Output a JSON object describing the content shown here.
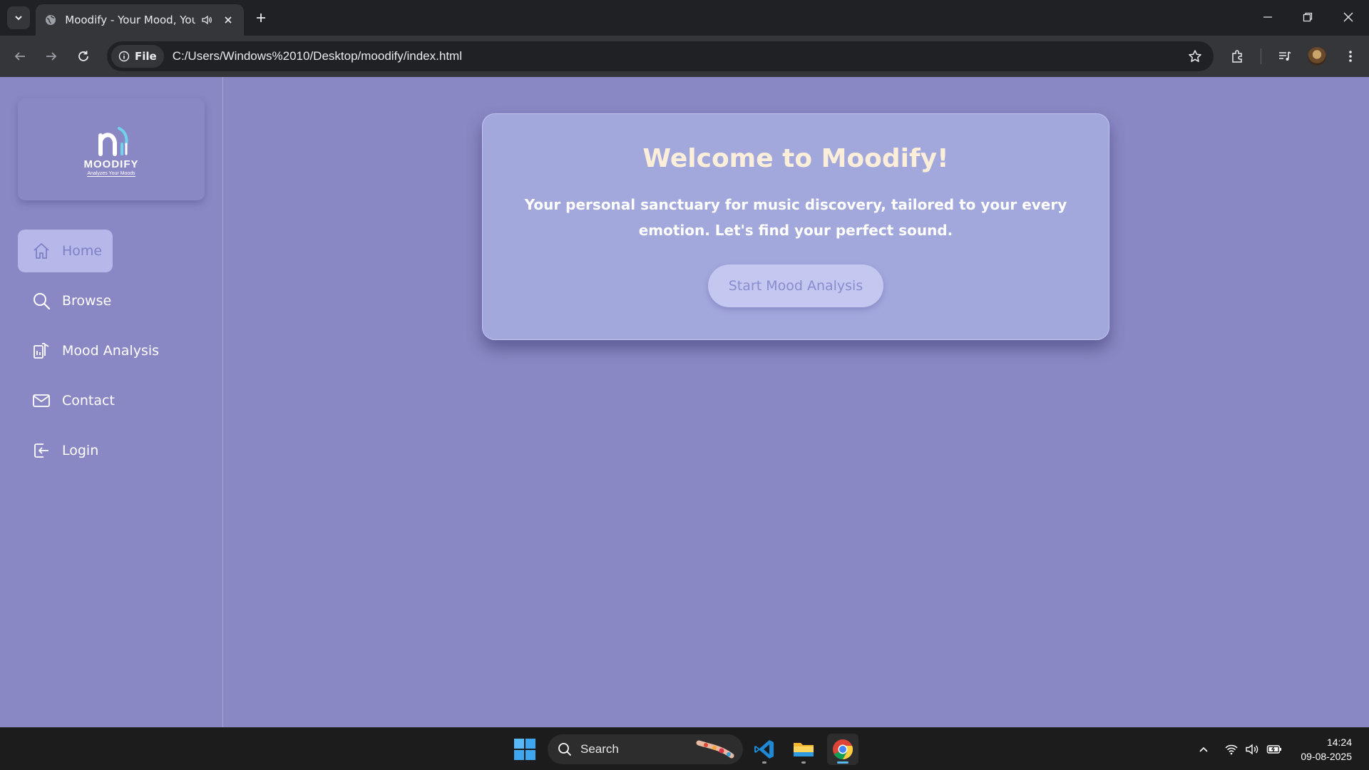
{
  "browser": {
    "tab": {
      "title": "Moodify - Your Mood, Your",
      "favicon": "globe-icon",
      "audio_icon": "speaker-icon"
    },
    "site_chip": "File",
    "url": "C:/Users/Windows%2010/Desktop/moodify/index.html"
  },
  "sidebar": {
    "logo": {
      "name": "MOODIFY",
      "tagline": "Analyzes Your Moods"
    },
    "items": [
      {
        "label": "Home",
        "icon": "home-icon",
        "active": true
      },
      {
        "label": "Browse",
        "icon": "search-icon",
        "active": false
      },
      {
        "label": "Mood Analysis",
        "icon": "mood-analysis-icon",
        "active": false
      },
      {
        "label": "Contact",
        "icon": "mail-icon",
        "active": false
      },
      {
        "label": "Login",
        "icon": "login-icon",
        "active": false
      }
    ]
  },
  "main": {
    "title": "Welcome to Moodify!",
    "text": "Your personal sanctuary for music discovery, tailored to your every emotion. Let's find your perfect sound.",
    "cta": "Start Mood Analysis"
  },
  "taskbar": {
    "search_label": "Search",
    "time": "14:24",
    "date": "09-08-2025"
  },
  "colors": {
    "page_bg": "#8a88c4",
    "card_bg": "#a2a7dc",
    "title": "#fcefd9",
    "active_nav_bg": "#b6b8ea",
    "cta_bg": "#c4c8f0"
  }
}
